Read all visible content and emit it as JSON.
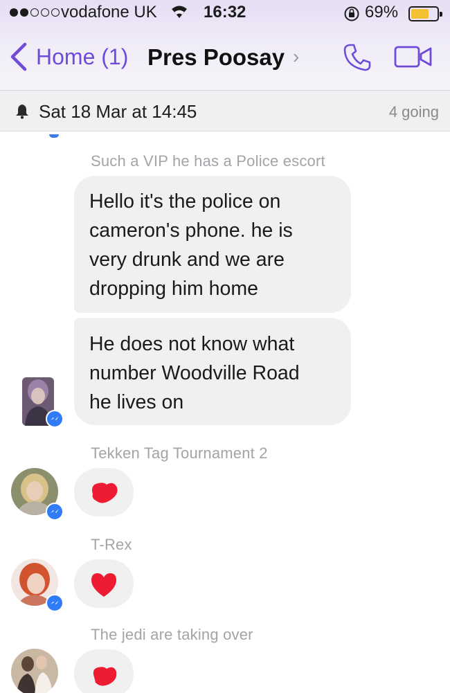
{
  "status_bar": {
    "carrier": "vodafone UK",
    "time": "16:32",
    "battery_percent": "69%",
    "battery_level": 0.69,
    "signal_bars_filled": 2,
    "signal_bars_total": 5
  },
  "nav": {
    "back_label": "Home (1)",
    "title": "Pres Poosay",
    "title_chevron": "›"
  },
  "event": {
    "date": "Sat 18 Mar at 14:45",
    "going": "4 going"
  },
  "messages": [
    {
      "caption": "Such a VIP he has a Police escort",
      "bubble_lines": [
        [
          "Hello it's the police on",
          "cameron's phone.  he is",
          "very drunk and we are",
          "dropping him home"
        ],
        [
          "He does not know what",
          "number Woodville Road",
          "he lives on"
        ]
      ],
      "sender_avatar": "avatar-purple-hair"
    },
    {
      "caption": "Tekken Tag Tournament 2",
      "sticker": "heart-sticker",
      "sender_avatar": "avatar-blonde"
    },
    {
      "caption": "T-Rex",
      "sticker": "heart-sticker",
      "sender_avatar": "avatar-red-hair"
    },
    {
      "caption": "The jedi are taking over",
      "sticker": "heart-sticker",
      "sender_avatar": "avatar-couple"
    }
  ],
  "colors": {
    "accent": "#6f4bd8",
    "bubble": "#f0f0f0",
    "heart": "#ee1c32",
    "messenger_badge": "#2f7cf6",
    "battery": "#f1c232"
  },
  "icons": [
    "back-chevron-icon",
    "phone-icon",
    "video-camera-icon",
    "bell-icon",
    "wifi-icon",
    "rotation-lock-icon",
    "messenger-badge-icon",
    "heart-sticker-icon"
  ]
}
